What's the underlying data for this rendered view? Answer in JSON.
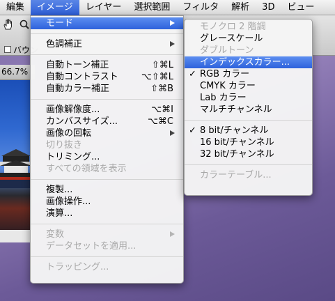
{
  "menubar": {
    "items": [
      "編集",
      "イメージ",
      "レイヤー",
      "選択範囲",
      "フィルタ",
      "解析",
      "3D",
      "ビュー"
    ]
  },
  "toolbar": {
    "bounding_label": "バウン",
    "zoom_value": "66.7%"
  },
  "image_menu": {
    "mode": "モード",
    "adjustments": "色調補正",
    "auto_tone": "自動トーン補正",
    "auto_tone_shortcut": "⇧⌘L",
    "auto_contrast": "自動コントラスト",
    "auto_contrast_shortcut": "⌥⇧⌘L",
    "auto_color": "自動カラー補正",
    "auto_color_shortcut": "⇧⌘B",
    "image_size": "画像解像度...",
    "image_size_shortcut": "⌥⌘I",
    "canvas_size": "カンバスサイズ...",
    "canvas_size_shortcut": "⌥⌘C",
    "rotation": "画像の回転",
    "crop": "切り抜き",
    "trim": "トリミング...",
    "reveal_all": "すべての領域を表示",
    "duplicate": "複製...",
    "apply_image": "画像操作...",
    "calculations": "演算...",
    "variables": "変数",
    "apply_data_set": "データセットを適用...",
    "trap": "トラッピング..."
  },
  "mode_menu": {
    "bitmap": "モノクロ 2 階調",
    "grayscale": "グレースケール",
    "duotone": "ダブルトーン",
    "indexed": "インデックスカラー...",
    "rgb": "RGB カラー",
    "cmyk": "CMYK カラー",
    "lab": "Lab カラー",
    "multichannel": "マルチチャンネル",
    "bit8": "8 bit/チャンネル",
    "bit16": "16 bit/チャンネル",
    "bit32": "32 bit/チャンネル",
    "color_table": "カラーテーブル...",
    "checkmark": "✓"
  }
}
